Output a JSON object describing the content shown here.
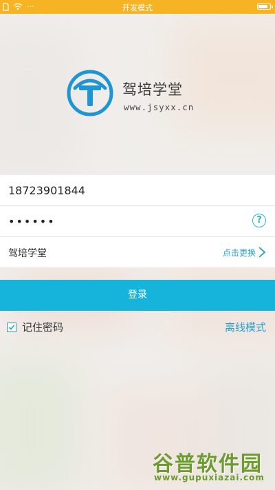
{
  "status_bar": {
    "title": "开发模式",
    "indicators": "···",
    "battery_level": 0.85
  },
  "brand": {
    "name": "驾培学堂",
    "site": "www.jsyxx.cn"
  },
  "form": {
    "phone_value": "18723901844",
    "password_value": "••••••",
    "help_icon_glyph": "?",
    "school_name": "驾培学堂",
    "change_link": "点击更换"
  },
  "login": {
    "label": "登录"
  },
  "options": {
    "remember_label": "记住密码",
    "remember_checked": true,
    "offline_label": "离线模式"
  },
  "watermark": {
    "title": "谷普软件园",
    "url": "www.gupuxiazai.com"
  },
  "colors": {
    "status_bar": "#f6b324",
    "accent": "#16b3da",
    "link": "#2a9fce",
    "logo": "#1e96d3"
  }
}
